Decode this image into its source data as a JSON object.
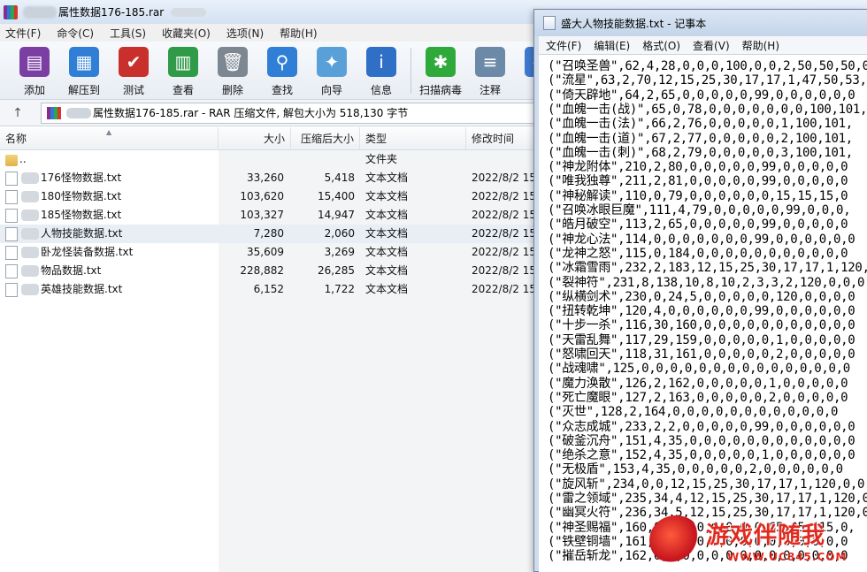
{
  "rar": {
    "title": "属性数据176-185.rar",
    "menu": [
      "文件(F)",
      "命令(C)",
      "工具(S)",
      "收藏夹(O)",
      "选项(N)",
      "帮助(H)"
    ],
    "toolbar": [
      {
        "label": "添加",
        "icon": "add-archive-icon",
        "color": "#7b3fa3"
      },
      {
        "label": "解压到",
        "icon": "extract-to-icon",
        "color": "#2f7fd6"
      },
      {
        "label": "测试",
        "icon": "test-clipboard-icon",
        "color": "#c9302c"
      },
      {
        "label": "查看",
        "icon": "view-book-icon",
        "color": "#2f9a48"
      },
      {
        "label": "删除",
        "icon": "trash-icon",
        "color": "#7d8792"
      },
      {
        "label": "查找",
        "icon": "magnifier-icon",
        "color": "#2f7fd6"
      },
      {
        "label": "向导",
        "icon": "wizard-wand-icon",
        "color": "#5aa0d8"
      },
      {
        "label": "信息",
        "icon": "info-icon",
        "color": "#2f6fc6"
      },
      {
        "label": "扫描病毒",
        "icon": "virus-scan-icon",
        "color": "#2faa3a"
      },
      {
        "label": "注释",
        "icon": "comment-icon",
        "color": "#6c8aa8"
      },
      {
        "label": "保",
        "icon": "protect-icon",
        "color": "#3f7ad0"
      }
    ],
    "address": "属性数据176-185.rar - RAR 压缩文件, 解包大小为 518,130 字节",
    "columns": [
      "名称",
      "大小",
      "压缩后大小",
      "类型",
      "修改时间"
    ],
    "files": [
      {
        "name": "..",
        "size": "",
        "packed": "",
        "type": "文件夹",
        "mtime": "",
        "folder": true
      },
      {
        "name": "176怪物数据.txt",
        "size": "33,260",
        "packed": "5,418",
        "type": "文本文档",
        "mtime": "2022/8/2 15"
      },
      {
        "name": "180怪物数据.txt",
        "size": "103,620",
        "packed": "15,400",
        "type": "文本文档",
        "mtime": "2022/8/2 15"
      },
      {
        "name": "185怪物数据.txt",
        "size": "103,327",
        "packed": "14,947",
        "type": "文本文档",
        "mtime": "2022/8/2 15"
      },
      {
        "name": "人物技能数据.txt",
        "size": "7,280",
        "packed": "2,060",
        "type": "文本文档",
        "mtime": "2022/8/2 15",
        "selected": true
      },
      {
        "name": "卧龙怪装备数据.txt",
        "size": "35,609",
        "packed": "3,269",
        "type": "文本文档",
        "mtime": "2022/8/2 15"
      },
      {
        "name": "物品数据.txt",
        "size": "228,882",
        "packed": "26,285",
        "type": "文本文档",
        "mtime": "2022/8/2 15"
      },
      {
        "name": "英雄技能数据.txt",
        "size": "6,152",
        "packed": "1,722",
        "type": "文本文档",
        "mtime": "2022/8/2 15"
      }
    ]
  },
  "notepad": {
    "title": "盛大人物技能数据.txt - 记事本",
    "menu": [
      "文件(F)",
      "编辑(E)",
      "格式(O)",
      "查看(V)",
      "帮助(H)"
    ],
    "lines": [
      "(\"召唤圣兽\",62,4,28,0,0,0,100,0,0,2,50,50,50,0",
      "(\"流星\",63,2,70,12,15,25,30,17,17,1,47,50,53,0",
      "(\"倚天辟地\",64,2,65,0,0,0,0,0,99,0,0,0,0,0,0",
      "(\"血魄一击(战)\",65,0,78,0,0,0,0,0,0,0,100,101,",
      "(\"血魄一击(法)\",66,2,76,0,0,0,0,0,1,100,101,",
      "(\"血魄一击(道)\",67,2,77,0,0,0,0,0,2,100,101,",
      "(\"血魄一击(刺)\",68,2,79,0,0,0,0,0,3,100,101,",
      "(\"神龙附体\",210,2,80,0,0,0,0,0,99,0,0,0,0,0",
      "(\"唯我独尊\",211,2,81,0,0,0,0,0,99,0,0,0,0,0",
      "(\"神秘解读\",110,0,79,0,0,0,0,0,0,15,15,15,0",
      "(\"召唤冰眼巨魔\",111,4,79,0,0,0,0,0,99,0,0,0,",
      "(\"皓月破空\",113,2,65,0,0,0,0,0,99,0,0,0,0,0",
      "(\"神龙心法\",114,0,0,0,0,0,0,0,99,0,0,0,0,0,0",
      "(\"龙神之怒\",115,0,184,0,0,0,0,0,0,0,0,0,0,0",
      "(\"冰霜雪雨\",232,2,183,12,15,25,30,17,17,1,120,",
      "(\"裂神符\",231,8,138,10,8,10,2,3,3,2,120,0,0,0",
      "(\"纵横剑术\",230,0,24,5,0,0,0,0,0,120,0,0,0,0",
      "(\"扭转乾坤\",120,4,0,0,0,0,0,0,99,0,0,0,0,0,0",
      "(\"十步一杀\",116,30,160,0,0,0,0,0,0,0,0,0,0,0",
      "(\"天雷乱舞\",117,29,159,0,0,0,0,0,1,0,0,0,0,0",
      "(\"怒啸回天\",118,31,161,0,0,0,0,0,2,0,0,0,0,0",
      "(\"战魂啸\",125,0,0,0,0,0,0,0,0,0,0,0,0,0,0,0",
      "(\"魔力涣散\",126,2,162,0,0,0,0,0,1,0,0,0,0,0",
      "(\"死亡魔眼\",127,2,163,0,0,0,0,0,2,0,0,0,0,0",
      "(\"灭世\",128,2,164,0,0,0,0,0,0,0,0,0,0,0,0",
      "(\"众志成城\",233,2,2,0,0,0,0,0,99,0,0,0,0,0,0",
      "(\"破釜沉舟\",151,4,35,0,0,0,0,0,0,0,0,0,0,0,0",
      "(\"绝杀之意\",152,4,35,0,0,0,0,0,1,0,0,0,0,0,0",
      "(\"无极盾\",153,4,35,0,0,0,0,0,2,0,0,0,0,0,0",
      "(\"旋风斩\",234,0,0,12,15,25,30,17,17,1,120,0,0",
      "(\"雷之领域\",235,34,4,12,15,25,30,17,17,1,120,0",
      "(\"幽冥火符\",236,34,5,12,15,25,30,17,17,1,120,0",
      "(\"神圣赐福\",160,0,0,0,0,0,0,0,0,65,85,115,0,",
      "(\"铁壁铜墙\",161,0,0,0,0,0,0,0,0,0,0,0,0,0,0",
      "(\"摧岳斩龙\",162,0,0,0,0,0,0,0,0,0,0,0,0,0,0"
    ]
  },
  "watermark": {
    "text": "游戏伴随我",
    "url": "WWW.UC845.COM"
  }
}
